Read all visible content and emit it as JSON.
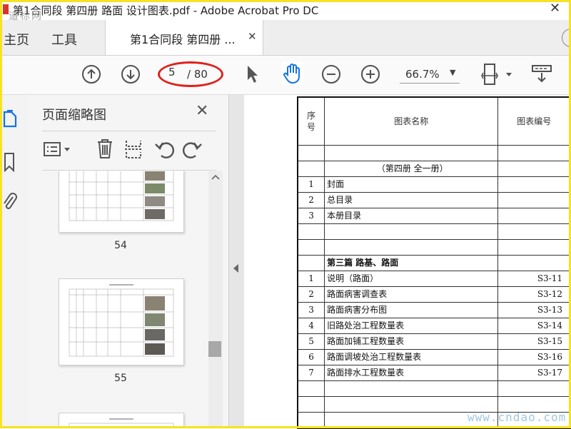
{
  "window": {
    "title": "第1合同段 第四册 路面 设计图表.pdf - Adobe Acrobat Pro DC",
    "close_glyph": "✕",
    "watermark_top": "道标网"
  },
  "tabs": {
    "home": "主页",
    "tools": "工具",
    "document": "第1合同段 第四册 ...",
    "close_glyph": "✕"
  },
  "toolbar": {
    "page_current": "5",
    "page_total": "/ 80",
    "zoom": "66.7%",
    "zoom_caret": "▼"
  },
  "panel": {
    "title": "页面缩略图",
    "close_glyph": "✕",
    "thumbnails": [
      {
        "page": "54"
      },
      {
        "page": "55"
      }
    ]
  },
  "document": {
    "header": {
      "col1": "序\n号",
      "col2": "图表名称",
      "col3": "图表编号"
    },
    "rows": [
      {
        "no": "",
        "name": "",
        "code": ""
      },
      {
        "no": "",
        "name": "（第四册  全一册）",
        "code": "",
        "center": true
      },
      {
        "no": "1",
        "name": "封面",
        "code": ""
      },
      {
        "no": "2",
        "name": "总目录",
        "code": ""
      },
      {
        "no": "3",
        "name": "本册目录",
        "code": ""
      },
      {
        "no": "",
        "name": "",
        "code": ""
      },
      {
        "no": "",
        "name": "",
        "code": ""
      },
      {
        "no": "",
        "name": "第三篇    路基、路面",
        "code": "",
        "bold": true
      },
      {
        "no": "1",
        "name": "说明（路面）",
        "code": "S3-11"
      },
      {
        "no": "2",
        "name": "路面病害调查表",
        "code": "S3-12"
      },
      {
        "no": "3",
        "name": "路面病害分布图",
        "code": "S3-13"
      },
      {
        "no": "4",
        "name": "旧路处治工程数量表",
        "code": "S3-14"
      },
      {
        "no": "5",
        "name": "路面加铺工程数量表",
        "code": "S3-15"
      },
      {
        "no": "6",
        "name": "路面调坡处治工程数量表",
        "code": "S3-16"
      },
      {
        "no": "7",
        "name": "路面排水工程数量表",
        "code": "S3-17"
      },
      {
        "no": "",
        "name": "",
        "code": ""
      },
      {
        "no": "",
        "name": "",
        "code": ""
      },
      {
        "no": "",
        "name": "",
        "code": ""
      }
    ]
  },
  "watermark_bottom": "www.cndao.com",
  "colors": {
    "frame": "#f7e223",
    "highlight_ellipse": "#e0201a",
    "hand_tool": "#1473e6"
  }
}
